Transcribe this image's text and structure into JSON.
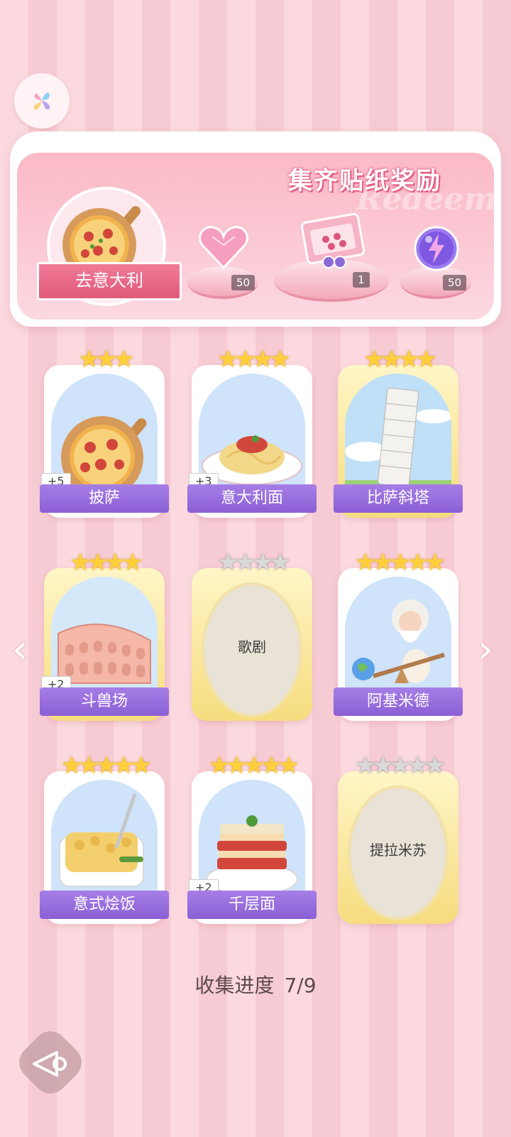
{
  "reward": {
    "title": "集齐贴纸奖励",
    "theme_name": "去意大利",
    "watermark": "Redeem",
    "items": [
      {
        "name": "heart-gem",
        "count": "50"
      },
      {
        "name": "gift-box",
        "count": "1"
      },
      {
        "name": "energy-orb",
        "count": "50"
      }
    ]
  },
  "stickers": [
    {
      "label": "披萨",
      "stars": 3,
      "plus": "+5",
      "collected": true
    },
    {
      "label": "意大利面",
      "stars": 4,
      "plus": "+3",
      "collected": true
    },
    {
      "label": "比萨斜塔",
      "stars": 4,
      "plus": "",
      "collected": true
    },
    {
      "label": "斗兽场",
      "stars": 4,
      "plus": "+2",
      "collected": true
    },
    {
      "label": "歌剧",
      "stars": 4,
      "plus": "",
      "collected": false
    },
    {
      "label": "阿基米德",
      "stars": 5,
      "plus": "",
      "collected": true
    },
    {
      "label": "意式烩饭",
      "stars": 5,
      "plus": "",
      "collected": true
    },
    {
      "label": "千层面",
      "stars": 5,
      "plus": "+2",
      "collected": true
    },
    {
      "label": "提拉米苏",
      "stars": 5,
      "plus": "",
      "collected": false
    }
  ],
  "progress": {
    "label": "收集进度",
    "value": "7/9"
  },
  "icons": {
    "left_arrow": "‹",
    "right_arrow": "›"
  },
  "colors": {
    "accent": "#e1597a",
    "label_purple": "#8b5fd4",
    "star_gold": "#ffcf3a"
  }
}
